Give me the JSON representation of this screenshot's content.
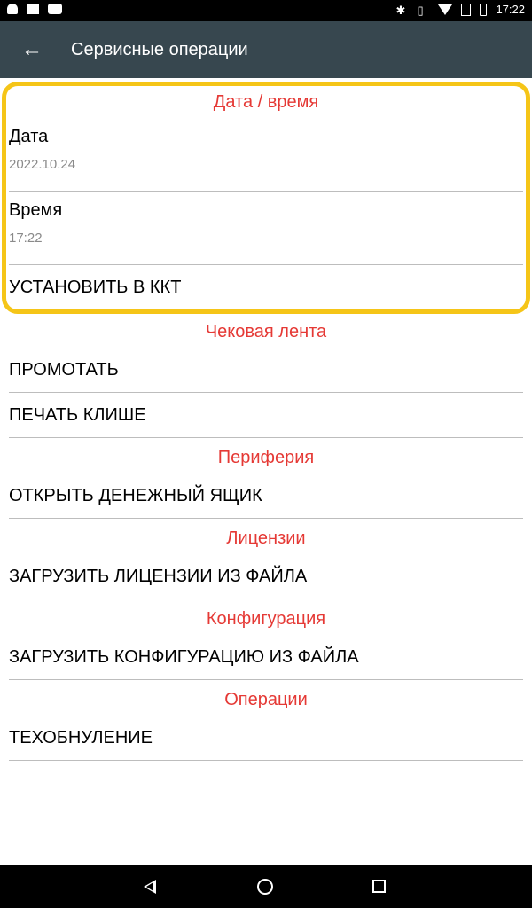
{
  "status_bar": {
    "time": "17:22"
  },
  "app_bar": {
    "title": "Сервисные операции",
    "back_icon": "arrow-left-icon"
  },
  "sections": {
    "datetime": {
      "header": "Дата / время",
      "date_title": "Дата",
      "date_value": "2022.10.24",
      "time_title": "Время",
      "time_value": "17:22",
      "set_action": "УСТАНОВИТЬ В ККТ"
    },
    "receipt_tape": {
      "header": "Чековая лента",
      "items": [
        "ПРОМОТАТЬ",
        "ПЕЧАТЬ КЛИШЕ"
      ]
    },
    "periphery": {
      "header": "Периферия",
      "items": [
        "ОТКРЫТЬ ДЕНЕЖНЫЙ ЯЩИК"
      ]
    },
    "licenses": {
      "header": "Лицензии",
      "items": [
        "ЗАГРУЗИТЬ ЛИЦЕНЗИИ ИЗ ФАЙЛА"
      ]
    },
    "configuration": {
      "header": "Конфигурация",
      "items": [
        "ЗАГРУЗИТЬ КОНФИГУРАЦИЮ ИЗ ФАЙЛА"
      ]
    },
    "operations": {
      "header": "Операции",
      "items": [
        "ТЕХОБНУЛЕНИЕ"
      ]
    }
  },
  "colors": {
    "app_bar": "#37474f",
    "section_header": "#e53935",
    "highlight": "#f5c518",
    "summary_text": "#8a8a8a"
  }
}
